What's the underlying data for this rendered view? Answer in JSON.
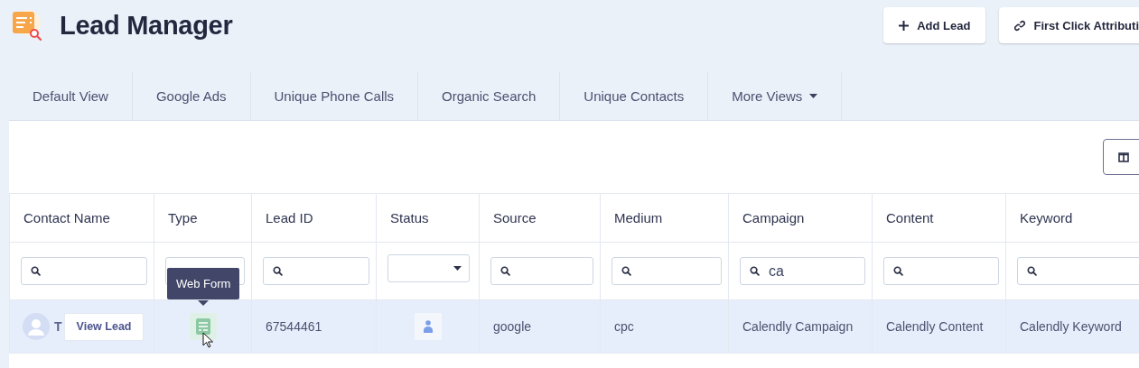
{
  "header": {
    "title": "Lead Manager",
    "buttons": [
      {
        "label": "Add Lead",
        "kind": "add"
      },
      {
        "label": "First Click Attributi",
        "kind": "link"
      }
    ]
  },
  "tabs": [
    {
      "label": "Default View",
      "menu": false
    },
    {
      "label": "Google Ads",
      "menu": false
    },
    {
      "label": "Unique Phone Calls",
      "menu": false
    },
    {
      "label": "Organic Search",
      "menu": false
    },
    {
      "label": "Unique Contacts",
      "menu": false
    },
    {
      "label": "More Views",
      "menu": true
    }
  ],
  "table": {
    "columns": [
      "Contact Name",
      "Type",
      "Lead ID",
      "Status",
      "Source",
      "Medium",
      "Campaign",
      "Content",
      "Keyword"
    ],
    "filters": [
      {
        "kind": "search"
      },
      {
        "kind": "text"
      },
      {
        "kind": "search"
      },
      {
        "kind": "select"
      },
      {
        "kind": "search"
      },
      {
        "kind": "search"
      },
      {
        "kind": "search",
        "value": "ca"
      },
      {
        "kind": "search"
      },
      {
        "kind": "search"
      }
    ],
    "rows": [
      {
        "selected": true,
        "contact": "T",
        "action": "View Lead",
        "type_tooltip": "Web Form",
        "lead_id": "67544461",
        "source": "google",
        "medium": "cpc",
        "campaign": "Calendly Campaign",
        "content": "Calendly Content",
        "keyword": "Calendly Keyword"
      }
    ]
  }
}
